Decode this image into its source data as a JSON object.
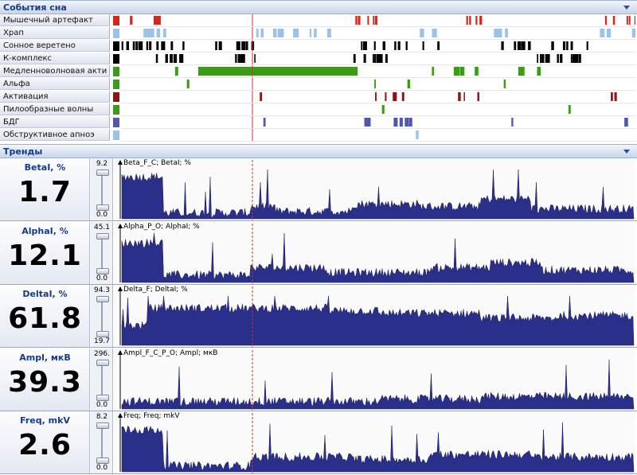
{
  "events_section": {
    "title": "События сна",
    "rows": [
      {
        "label": "Мышечный артефакт",
        "color": "#d8261d"
      },
      {
        "label": "Храп",
        "color": "#9cc3e6"
      },
      {
        "label": "Сонное веретено",
        "color": "#000000"
      },
      {
        "label": "К-комплекс",
        "color": "#000000"
      },
      {
        "label": "Медленноволновая акти",
        "color": "#3d9a1a"
      },
      {
        "label": "Альфа",
        "color": "#3d9a1a"
      },
      {
        "label": "Активация",
        "color": "#8b1414"
      },
      {
        "label": "Пилообразные волны",
        "color": "#3d9a1a"
      },
      {
        "label": "БДГ",
        "color": "#5157ad"
      },
      {
        "label": "Обструктивное апноэ",
        "color": "#9cc3e6"
      }
    ]
  },
  "trends_section": {
    "title": "Тренды",
    "cursor_color": "#c0392b",
    "fill_color": "#2a2f8a",
    "panels": [
      {
        "name": "BetaI, %",
        "value": "1.7",
        "max": "9.2",
        "min": "0.0",
        "chart_title": "Beta_F_C; BetaI; %",
        "slider_level": 0.0
      },
      {
        "name": "AlphaI, %",
        "value": "12.1",
        "max": "45.1",
        "min": "0.0",
        "chart_title": "Alpha_P_O; AlphaI; %",
        "slider_level": 0.0
      },
      {
        "name": "DeltaI, %",
        "value": "61.8",
        "max": "94.3",
        "min": "19.7",
        "chart_title": "Delta_F; DeltaI; %",
        "slider_level": 0.0
      },
      {
        "name": "Ampl, мкВ",
        "value": "39.3",
        "max": "296.",
        "min": "0.0",
        "chart_title": "Ampl_F_C_P_O; Ampl; мкВ",
        "slider_level": 0.0
      },
      {
        "name": "Freq, mkV",
        "value": "2.6",
        "max": "8.2",
        "min": "0.0",
        "chart_title": "Freq; Freq; mkV",
        "slider_level": 0.0
      }
    ]
  },
  "icons": {
    "events_collapse": "chevron-down-icon",
    "trends_collapse": "chevron-down-icon"
  }
}
